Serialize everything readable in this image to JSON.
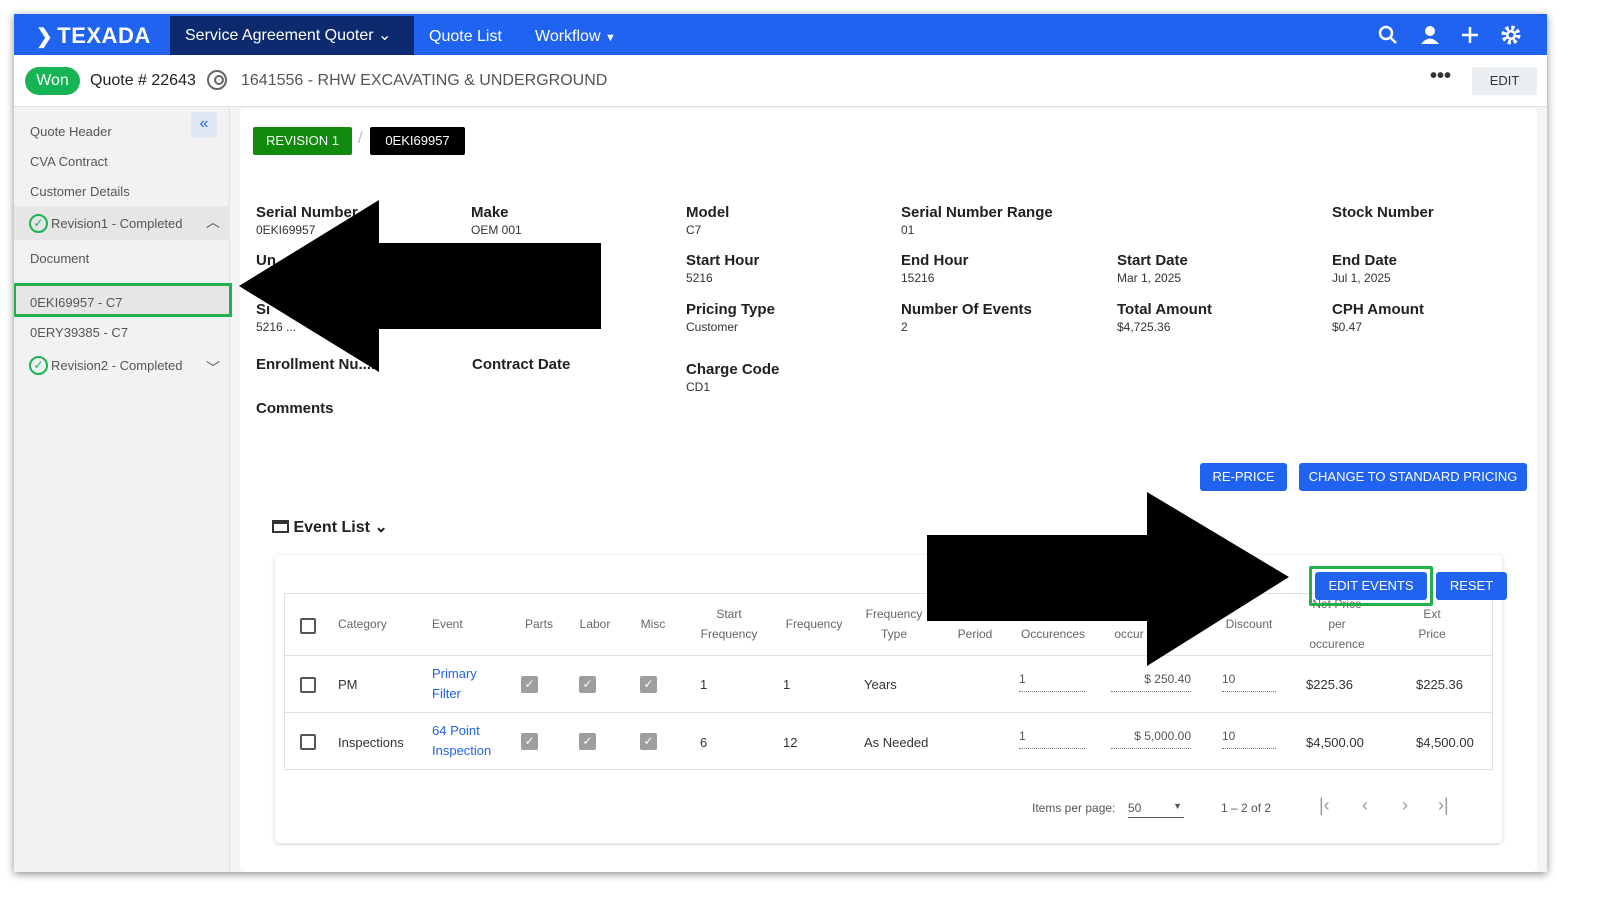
{
  "app": {
    "logo": "TEXADA",
    "module_tab": "Service Agreement Quoter",
    "nav": [
      "Quote List",
      "Workflow"
    ]
  },
  "topbar_icons": [
    "search-icon",
    "user-icon",
    "plus-icon",
    "gear-icon"
  ],
  "quote": {
    "status": "Won",
    "number": "Quote # 22643",
    "customer": "1641556 - RHW EXCAVATING & UNDERGROUND",
    "more": "•••",
    "edit_label": "EDIT"
  },
  "sidebar": {
    "collapse": "«",
    "items": [
      "Quote Header",
      "CVA Contract",
      "Customer Details"
    ],
    "revision1": "Revision1 - Completed",
    "document": "Document",
    "unit1": "0EKI69957 - C7",
    "unit2": "0ERY39385 - C7",
    "revision2": "Revision2 - Completed"
  },
  "breadcrumb": {
    "revision": "REVISION 1",
    "unit": "0EKI69957"
  },
  "fields": {
    "serial_number": {
      "label": "Serial Number",
      "value": "0EKI69957"
    },
    "make": {
      "label": "Make",
      "value": "OEM 001"
    },
    "model": {
      "label": "Model",
      "value": "C7"
    },
    "serial_range": {
      "label": "Serial Number Range",
      "value": "01"
    },
    "stock_number": {
      "label": "Stock Number",
      "value": ""
    },
    "unit_partial": {
      "label": "Un",
      "value": ""
    },
    "start_hour": {
      "label": "Start Hour",
      "value": "5216"
    },
    "end_hour": {
      "label": "End Hour",
      "value": "15216"
    },
    "start_date": {
      "label": "Start Date",
      "value": "Mar 1, 2025"
    },
    "end_date": {
      "label": "End Date",
      "value": "Jul 1, 2025"
    },
    "sm_partial": {
      "label": "Sı",
      "value": "5216 ..."
    },
    "pricing_type": {
      "label": "Pricing Type",
      "value": "Customer"
    },
    "num_events": {
      "label": "Number Of Events",
      "value": "2"
    },
    "total_amount": {
      "label": "Total Amount",
      "value": "$4,725.36"
    },
    "cph_amount": {
      "label": "CPH Amount",
      "value": "$0.47"
    },
    "enrollment": {
      "label": "Enrollment Nu...r",
      "value": ""
    },
    "contract_date": {
      "label": "Contract Date",
      "value": ""
    },
    "charge_code": {
      "label": "Charge Code",
      "value": "CD1"
    },
    "comments": {
      "label": "Comments",
      "value": ""
    }
  },
  "actions": {
    "reprice": "RE-PRICE",
    "standard": "CHANGE TO STANDARD PRICING",
    "edit_events": "EDIT EVENTS",
    "reset": "RESET"
  },
  "event_list": {
    "title": "Event List",
    "columns": [
      "Category",
      "Event",
      "Parts",
      "Labor",
      "Misc",
      "Start Frequency",
      "Frequency",
      "Frequency Type",
      "Period",
      "Occurences",
      "occur",
      "Discount",
      "Net Price per occurence",
      "Ext Price"
    ],
    "rows": [
      {
        "category": "PM",
        "event": "Primary Filter",
        "start_freq": "1",
        "frequency": "1",
        "freq_type": "Years",
        "occurences": "1",
        "price": "$ 250.40",
        "discount": "10",
        "net": "$225.36",
        "ext": "$225.36"
      },
      {
        "category": "Inspections",
        "event": "64 Point Inspection",
        "start_freq": "6",
        "frequency": "12",
        "freq_type": "As Needed",
        "occurences": "1",
        "price": "$ 5,000.00",
        "discount": "10",
        "net": "$4,500.00",
        "ext": "$4,500.00"
      }
    ],
    "items_per_page_label": "Items per page:",
    "items_per_page": "50",
    "range": "1 – 2 of 2"
  }
}
